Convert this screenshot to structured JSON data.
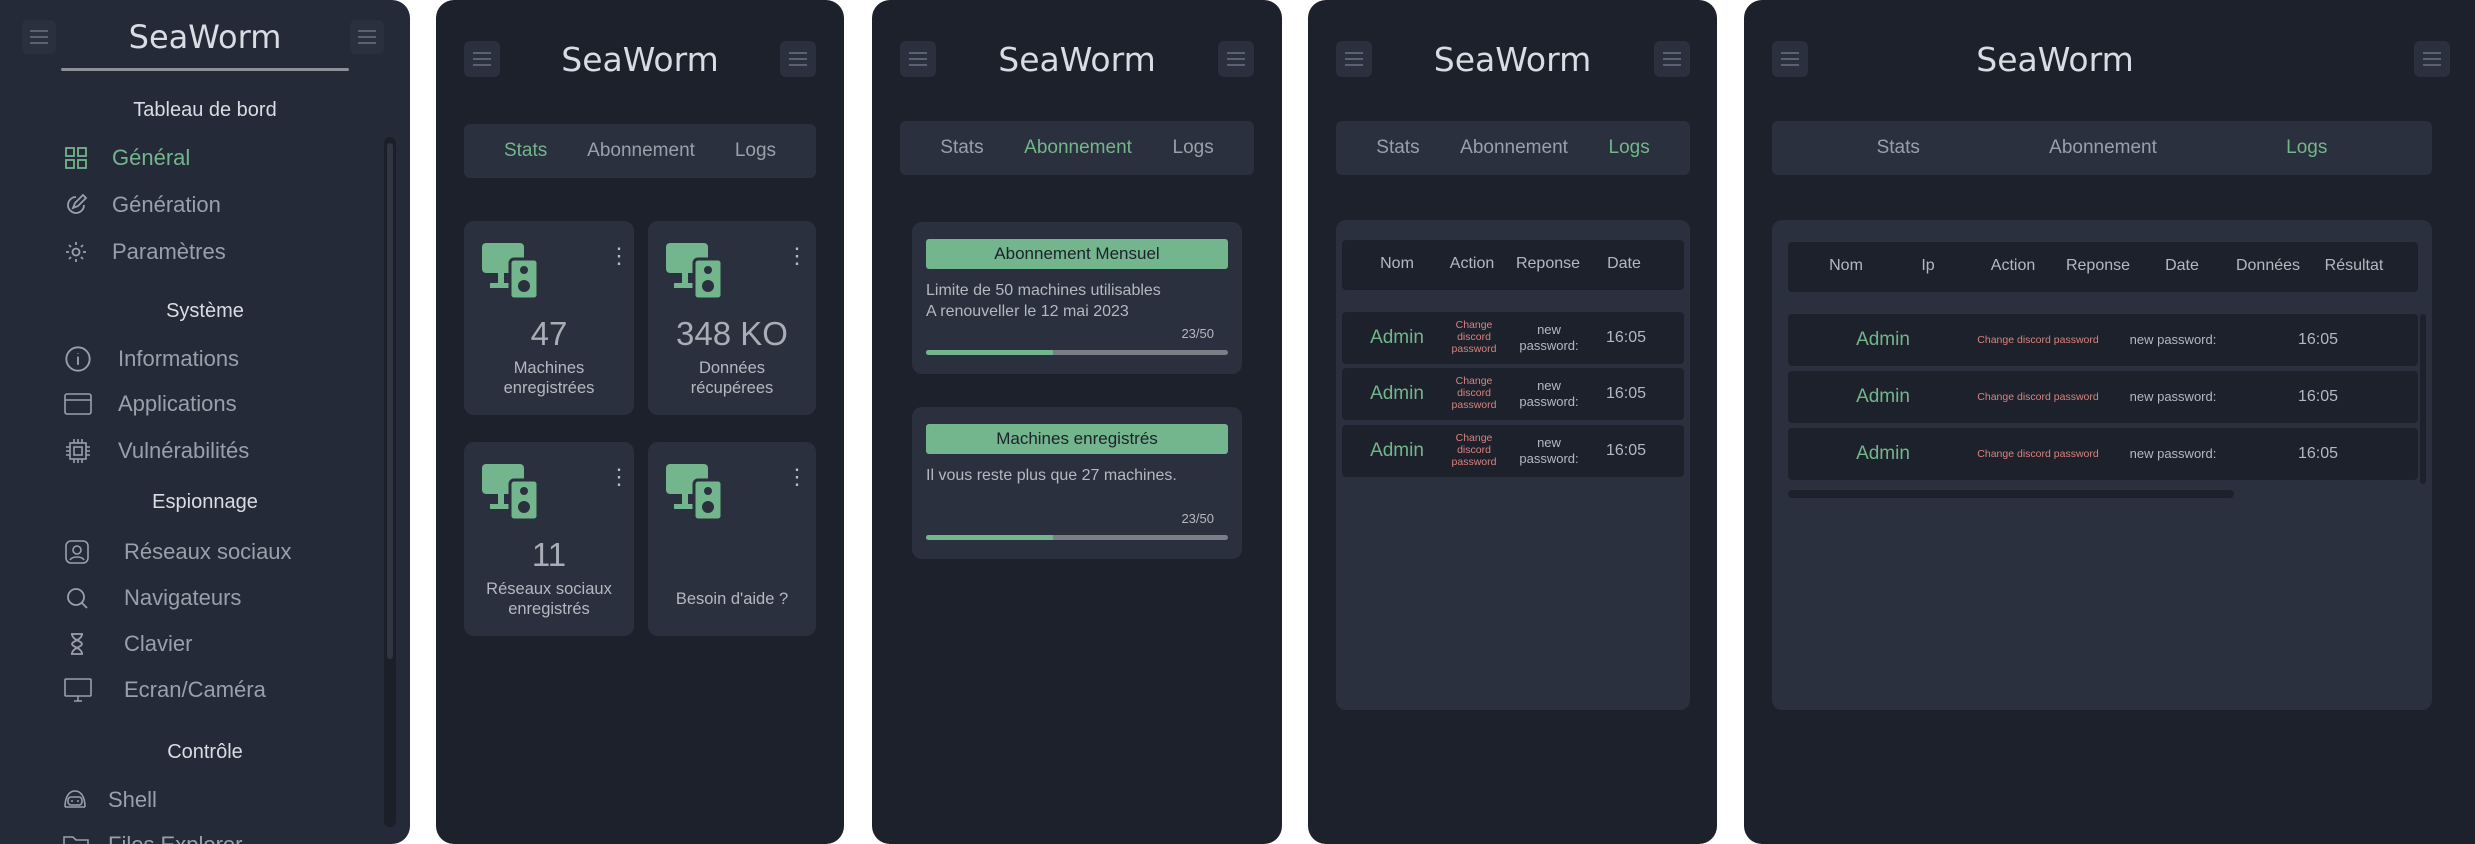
{
  "app": {
    "brand": "SeaWorm"
  },
  "colors": {
    "accent": "#73b58c",
    "background": "#1d212b",
    "surface": "#2a303d",
    "danger": "#d9837f"
  },
  "sidebar": {
    "sections": [
      {
        "title": "Tableau de bord",
        "items": [
          {
            "label": "Général",
            "icon": "grid-icon",
            "active": true
          },
          {
            "label": "Génération",
            "icon": "edit-icon"
          },
          {
            "label": "Paramètres",
            "icon": "gear-icon"
          }
        ]
      },
      {
        "title": "Système",
        "items": [
          {
            "label": "Informations",
            "icon": "info-icon"
          },
          {
            "label": "Applications",
            "icon": "window-icon"
          },
          {
            "label": "Vulnérabilités",
            "icon": "chip-icon"
          }
        ]
      },
      {
        "title": "Espionnage",
        "items": [
          {
            "label": "Réseaux sociaux",
            "icon": "contact-icon"
          },
          {
            "label": "Navigateurs",
            "icon": "search-icon"
          },
          {
            "label": "Clavier",
            "icon": "hourglass-icon"
          },
          {
            "label": "Ecran/Caméra",
            "icon": "monitor-icon"
          }
        ]
      },
      {
        "title": "Contrôle",
        "items": [
          {
            "label": "Shell",
            "icon": "hacker-icon"
          },
          {
            "label": "Files Explorer",
            "icon": "folder-icon"
          }
        ]
      }
    ]
  },
  "tabs": {
    "stats": "Stats",
    "subscription": "Abonnement",
    "logs": "Logs"
  },
  "stats": {
    "cards": [
      {
        "value": "47",
        "caption_1": "Machines",
        "caption_2": "enregistrées"
      },
      {
        "value": "348 KO",
        "caption_1": "Données",
        "caption_2": "récupérees"
      },
      {
        "value": "11",
        "caption_1": "Réseaux sociaux",
        "caption_2": "enregistrés"
      },
      {
        "value": "",
        "caption_1": "Besoin d'aide ?",
        "caption_2": ""
      }
    ]
  },
  "subscription": {
    "monthly": {
      "title": "Abonnement Mensuel",
      "line1": "Limite de 50 machines utilisables",
      "line2": "A renouveller le 12 mai 2023",
      "progress_text": "23/50",
      "progress": 0.42
    },
    "machines": {
      "title": "Machines enregistrés",
      "line1": "Il vous reste plus que 27 machines.",
      "progress_text": "23/50",
      "progress": 0.42
    }
  },
  "logs": {
    "columns_short": [
      "Nom",
      "Action",
      "Reponse",
      "Date"
    ],
    "columns_full": [
      "Nom",
      "Ip",
      "Action",
      "Reponse",
      "Date",
      "Données",
      "Résultat"
    ],
    "rows": [
      {
        "name": "Admin",
        "action": "Change discord password",
        "action_l1": "Change",
        "action_l2": "discord",
        "action_l3": "password",
        "response": "new password:",
        "response_l1": "new",
        "response_l2": "password:",
        "date": "16:05"
      },
      {
        "name": "Admin",
        "action": "Change discord password",
        "action_l1": "Change",
        "action_l2": "discord",
        "action_l3": "password",
        "response": "new password:",
        "response_l1": "new",
        "response_l2": "password:",
        "date": "16:05"
      },
      {
        "name": "Admin",
        "action": "Change discord password",
        "action_l1": "Change",
        "action_l2": "discord",
        "action_l3": "password",
        "response": "new password:",
        "response_l1": "new",
        "response_l2": "password:",
        "date": "16:05"
      }
    ]
  }
}
